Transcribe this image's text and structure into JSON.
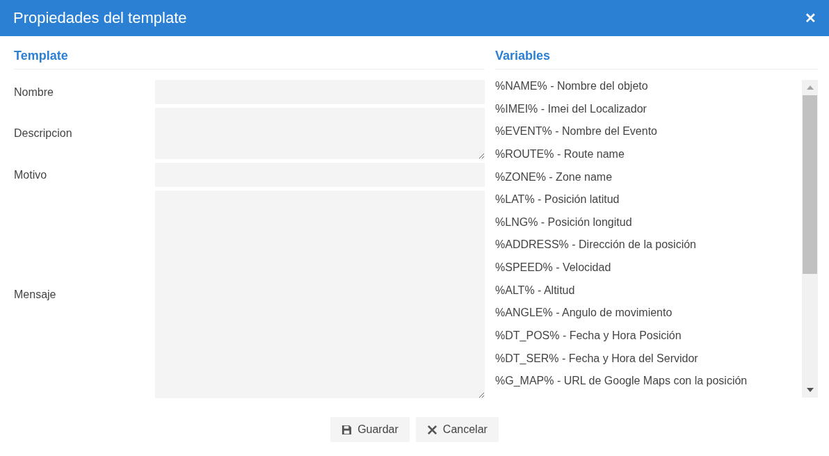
{
  "window": {
    "title": "Propiedades del template",
    "close": "✕"
  },
  "template": {
    "heading": "Template",
    "fields": [
      {
        "label": "Nombre",
        "kind": "input"
      },
      {
        "label": "Descripcion",
        "kind": "textarea"
      },
      {
        "label": "Motivo",
        "kind": "input"
      },
      {
        "label": "Mensaje",
        "kind": "tallarea"
      }
    ]
  },
  "variables": {
    "heading": "Variables",
    "items": [
      "%NAME% - Nombre del objeto",
      "%IMEI% - Imei del Localizador",
      "%EVENT% - Nombre del Evento",
      "%ROUTE% - Route name",
      "%ZONE% - Zone name",
      "%LAT% - Posición latitud",
      "%LNG% - Posición longitud",
      "%ADDRESS% - Dirección de la posición",
      "%SPEED% - Velocidad",
      "%ALT% - Altitud",
      "%ANGLE% - Angulo de movimiento",
      "%DT_POS% - Fecha y Hora Posición",
      "%DT_SER% - Fecha y Hora del Servidor",
      "%G_MAP% - URL de Google Maps con la posición"
    ]
  },
  "buttons": [
    {
      "label": "Guardar",
      "kind": "save"
    },
    {
      "label": "Cancelar",
      "kind": "cancel"
    }
  ]
}
